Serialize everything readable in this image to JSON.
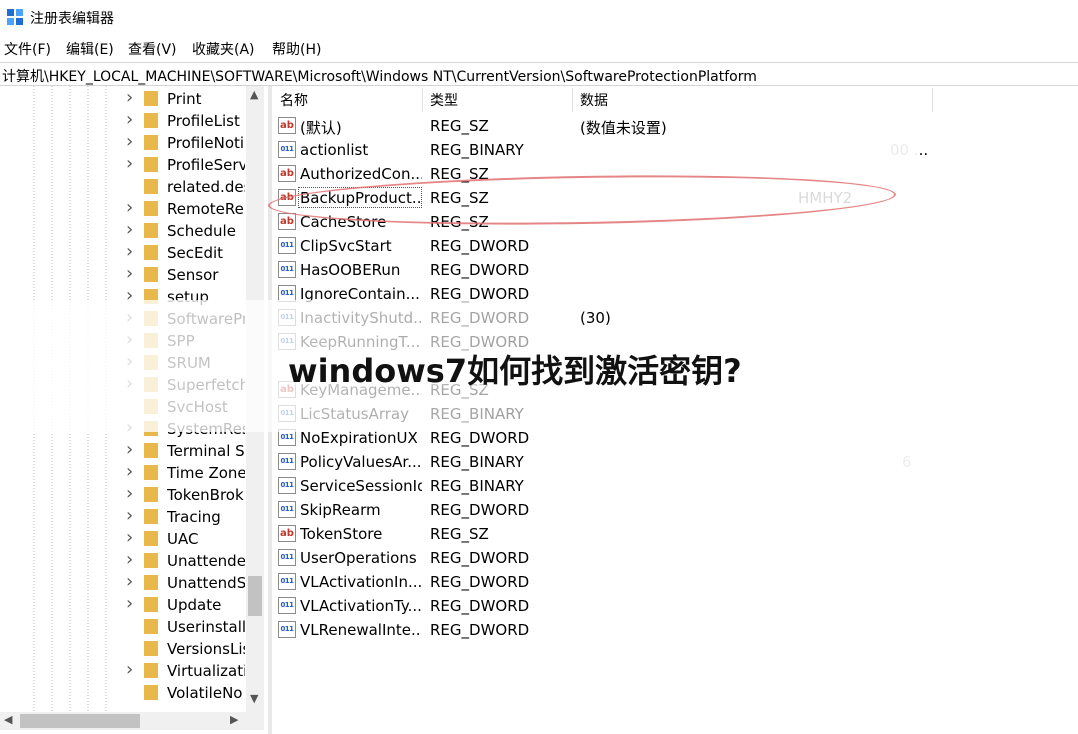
{
  "window": {
    "title": "注册表编辑器",
    "app_icon": "registry-editor-icon"
  },
  "menu": [
    "文件(F)",
    "编辑(E)",
    "查看(V)",
    "收藏夹(A)",
    "帮助(H)"
  ],
  "address": "计算机\\HKEY_LOCAL_MACHINE\\SOFTWARE\\Microsoft\\Windows NT\\CurrentVersion\\SoftwareProtectionPlatform",
  "tree": {
    "items": [
      {
        "label": "Print",
        "expandable": true
      },
      {
        "label": "ProfileList",
        "expandable": true
      },
      {
        "label": "ProfileNoti",
        "expandable": true
      },
      {
        "label": "ProfileServ",
        "expandable": true
      },
      {
        "label": "related.des",
        "expandable": false
      },
      {
        "label": "RemoteRe",
        "expandable": true
      },
      {
        "label": "Schedule",
        "expandable": true
      },
      {
        "label": "SecEdit",
        "expandable": true
      },
      {
        "label": "Sensor",
        "expandable": true
      },
      {
        "label": "setup",
        "expandable": true
      },
      {
        "label": "SoftwarePr",
        "expandable": true
      },
      {
        "label": "SPP",
        "expandable": true
      },
      {
        "label": "SRUM",
        "expandable": true
      },
      {
        "label": "Superfetch",
        "expandable": true
      },
      {
        "label": "SvcHost",
        "expandable": false
      },
      {
        "label": "SystemRes",
        "expandable": true
      },
      {
        "label": "Terminal S",
        "expandable": true
      },
      {
        "label": "Time Zone",
        "expandable": true
      },
      {
        "label": "TokenBrok",
        "expandable": true
      },
      {
        "label": "Tracing",
        "expandable": true
      },
      {
        "label": "UAC",
        "expandable": true
      },
      {
        "label": "Unattende",
        "expandable": true
      },
      {
        "label": "UnattendS",
        "expandable": true
      },
      {
        "label": "Update",
        "expandable": true
      },
      {
        "label": "Userinstalla",
        "expandable": false
      },
      {
        "label": "VersionsLis",
        "expandable": false
      },
      {
        "label": "Virtualizati",
        "expandable": true
      },
      {
        "label": "VolatileNo",
        "expandable": false
      }
    ]
  },
  "list": {
    "headers": {
      "name": "名称",
      "type": "类型",
      "data": "数据"
    },
    "rows": [
      {
        "icon": "ab",
        "name": "(默认)",
        "type": "REG_SZ",
        "data": "(数值未设置)"
      },
      {
        "icon": "bin",
        "name": "actionlist",
        "type": "REG_BINARY",
        "data": "00 ..."
      },
      {
        "icon": "ab",
        "name": "AuthorizedCon...",
        "type": "REG_SZ",
        "data": ""
      },
      {
        "icon": "ab",
        "name": "BackupProduct...",
        "type": "REG_SZ",
        "data": "HMHY2"
      },
      {
        "icon": "ab",
        "name": "CacheStore",
        "type": "REG_SZ",
        "data": ""
      },
      {
        "icon": "bin",
        "name": "ClipSvcStart",
        "type": "REG_DWORD",
        "data": ""
      },
      {
        "icon": "bin",
        "name": "HasOOBERun",
        "type": "REG_DWORD",
        "data": ""
      },
      {
        "icon": "bin",
        "name": "IgnoreContain...",
        "type": "REG_DWORD",
        "data": ""
      },
      {
        "icon": "bin",
        "name": "InactivityShutd...",
        "type": "REG_DWORD",
        "data": "(30)"
      },
      {
        "icon": "bin",
        "name": "KeepRunningT...",
        "type": "REG_DWORD",
        "data": ""
      },
      {
        "icon": "ab",
        "name": "",
        "type": "",
        "data": ""
      },
      {
        "icon": "ab",
        "name": "KeyManageme...",
        "type": "REG_SZ",
        "data": ""
      },
      {
        "icon": "bin",
        "name": "LicStatusArray",
        "type": "REG_BINARY",
        "data": ""
      },
      {
        "icon": "bin",
        "name": "NoExpirationUX",
        "type": "REG_DWORD",
        "data": ""
      },
      {
        "icon": "bin",
        "name": "PolicyValuesAr...",
        "type": "REG_BINARY",
        "data": "6"
      },
      {
        "icon": "bin",
        "name": "ServiceSessionId",
        "type": "REG_BINARY",
        "data": ""
      },
      {
        "icon": "bin",
        "name": "SkipRearm",
        "type": "REG_DWORD",
        "data": ""
      },
      {
        "icon": "ab",
        "name": "TokenStore",
        "type": "REG_SZ",
        "data": ""
      },
      {
        "icon": "bin",
        "name": "UserOperations",
        "type": "REG_DWORD",
        "data": ""
      },
      {
        "icon": "bin",
        "name": "VLActivationIn...",
        "type": "REG_DWORD",
        "data": ""
      },
      {
        "icon": "bin",
        "name": "VLActivationTy...",
        "type": "REG_DWORD",
        "data": ""
      },
      {
        "icon": "bin",
        "name": "VLRenewalInte...",
        "type": "REG_DWORD",
        "data": ""
      }
    ]
  },
  "overlay": {
    "title": "windows7如何找到激活密钥?"
  },
  "colors": {
    "highlight_ellipse": "#e07070",
    "folder": "#e8b84a",
    "sz_icon": "#c0392b",
    "binary_icon": "#1f5fbf"
  }
}
